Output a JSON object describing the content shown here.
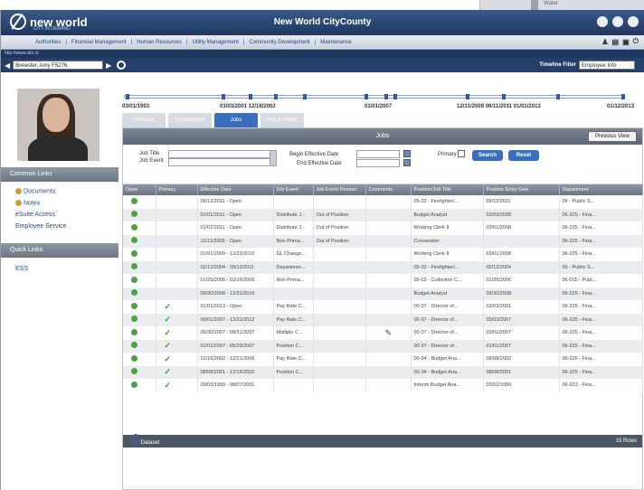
{
  "background": {
    "peek_text": "Water"
  },
  "titlebar": {
    "logo_text": "new world",
    "logo_sub": "CITY IN DEMAND",
    "title": "New World CityCounty"
  },
  "menu": {
    "items": [
      "Authorities",
      "Financial Management",
      "Human Resources",
      "Utility Management",
      "Community Development",
      "Maintenance"
    ]
  },
  "addrbar": {
    "text": "http://www.site.nl"
  },
  "toolbar": {
    "crumb_value": "Brewster, Amy F5276",
    "timeline_filter_label": "Timeline Filter",
    "timeline_filter_value": "Employee Info"
  },
  "sidebar": {
    "common_links_title": "Common Links",
    "common_links": [
      "Documents",
      "Notes",
      "eSuite Access",
      "Employee Service"
    ],
    "quick_links_title": "Quick Links",
    "quick_links": [
      "ESS"
    ]
  },
  "timeline": {
    "dates": [
      "03/01/1993",
      "03/03/2001 12/16/2002",
      "01/01/2007",
      "12/31/2009 06/11/2011 01/01/2013",
      "01/12/2013"
    ]
  },
  "tabs": [
    "Personal",
    "Employment",
    "Jobs",
    "Pay & Hours"
  ],
  "panel": {
    "title": "Jobs",
    "previous_view": "Previous View",
    "filters": {
      "job_title_label": "Job Title",
      "job_event_label": "Job Event",
      "begin_date_label": "Begin Effective Date",
      "end_date_label": "End Effective Date",
      "primary_label": "Primary",
      "search_label": "Search",
      "reset_label": "Reset"
    },
    "columns": [
      "Open",
      "Primary",
      "Effective Date",
      "Job Event",
      "Job Event Reason",
      "Comments",
      "Position/Job Title",
      "Position Entry Date",
      "Department"
    ],
    "rows": [
      {
        "open": true,
        "primary": false,
        "dates": "09/12/2011 - Open",
        "event": "",
        "reason": "",
        "comments": "",
        "title": "05-32 - Firefighter/...",
        "entry": "09/12/2011",
        "dept": "09 - Public S..."
      },
      {
        "open": true,
        "primary": false,
        "dates": "01/01/2011 - Open",
        "event": "Distribute J...",
        "reason": "Out of Position",
        "comments": "",
        "title": "Budget Analyst",
        "entry": "03/03/2008",
        "dept": "06-225 - Fina..."
      },
      {
        "open": true,
        "primary": false,
        "dates": "01/01/2011 - Open",
        "event": "Distribute J...",
        "reason": "Out of Position",
        "comments": "",
        "title": "Working Clerk II",
        "entry": "03/01/2008",
        "dept": "06-225 - Fina..."
      },
      {
        "open": true,
        "primary": false,
        "dates": "12/11/2009 - Open",
        "event": "Non-Prima...",
        "reason": "Out of Position",
        "comments": "",
        "title": "Conversion",
        "entry": "",
        "dept": "06-225 - Fina..."
      },
      {
        "open": true,
        "primary": false,
        "dates": "01/01/2009 - 12/31/2010",
        "event": "GL Change...",
        "reason": "",
        "comments": "",
        "title": "Working Clerk II",
        "entry": "03/01/2008",
        "dept": "06-225 - Fina..."
      },
      {
        "open": true,
        "primary": false,
        "dates": "02/12/2004 - 09/12/2011",
        "event": "Departmen...",
        "reason": "",
        "comments": "",
        "title": "05-32 - Firefighter/...",
        "entry": "02/12/2004",
        "dept": "09 - Public S..."
      },
      {
        "open": true,
        "primary": false,
        "dates": "01/25/2006 - 02/16/2006",
        "event": "Non-Prima...",
        "reason": "",
        "comments": "",
        "title": "05-03 - Collection C...",
        "entry": "01/25/2006",
        "dept": "06-015 - Publ..."
      },
      {
        "open": true,
        "primary": false,
        "dates": "09/30/2008 - 12/31/2010",
        "event": "",
        "reason": "",
        "comments": "",
        "title": "Budget Analyst",
        "entry": "09/30/2008",
        "dept": "06-225 - Fina..."
      },
      {
        "open": true,
        "primary": true,
        "dates": "01/01/2013 - Open",
        "event": "Pay Rate C...",
        "reason": "",
        "comments": "",
        "title": "00-37 - Director of...",
        "entry": "03/03/2001",
        "dept": "06-225 - Fina..."
      },
      {
        "open": true,
        "primary": true,
        "dates": "09/01/2007 - 12/31/2012",
        "event": "Pay Rate C...",
        "reason": "",
        "comments": "",
        "title": "00-37 - Director of...",
        "entry": "03/03/2007",
        "dept": "06-225 - Fina..."
      },
      {
        "open": true,
        "primary": true,
        "dates": "05/30/2007 - 08/31/2007",
        "event": "Multiple C...",
        "reason": "",
        "comments": "comment",
        "title": "00-37 - Director of...",
        "entry": "03/01/2007",
        "dept": "06-225 - Fina..."
      },
      {
        "open": true,
        "primary": true,
        "dates": "01/01/2007 - 05/29/2007",
        "event": "Position C...",
        "reason": "",
        "comments": "",
        "title": "00-37 - Director of...",
        "entry": "01/01/2007",
        "dept": "06-225 - Fina..."
      },
      {
        "open": true,
        "primary": true,
        "dates": "12/16/2002 - 12/31/2006",
        "event": "Pay Rate C...",
        "reason": "",
        "comments": "",
        "title": "00-34 - Budget Ana...",
        "entry": "08/08/2002",
        "dept": "06-225 - Fina..."
      },
      {
        "open": true,
        "primary": true,
        "dates": "08/08/2001 - 12/15/2002",
        "event": "Position C...",
        "reason": "",
        "comments": "",
        "title": "00-34 - Budget Ana...",
        "entry": "08/08/2001",
        "dept": "06-225 - Fina..."
      },
      {
        "open": true,
        "primary": true,
        "dates": "03/02/1999 - 08/07/2001",
        "event": "",
        "reason": "",
        "comments": "",
        "title": "Interim Budget Ana...",
        "entry": "03/02/1999",
        "dept": "06-222 - Fina..."
      }
    ],
    "footer_left": "Dataset",
    "footer_right": "15 Rows"
  },
  "colors": {
    "accent": "#3a6fc0",
    "titlebar": "#1d3660",
    "ok_green": "#4aa240"
  }
}
